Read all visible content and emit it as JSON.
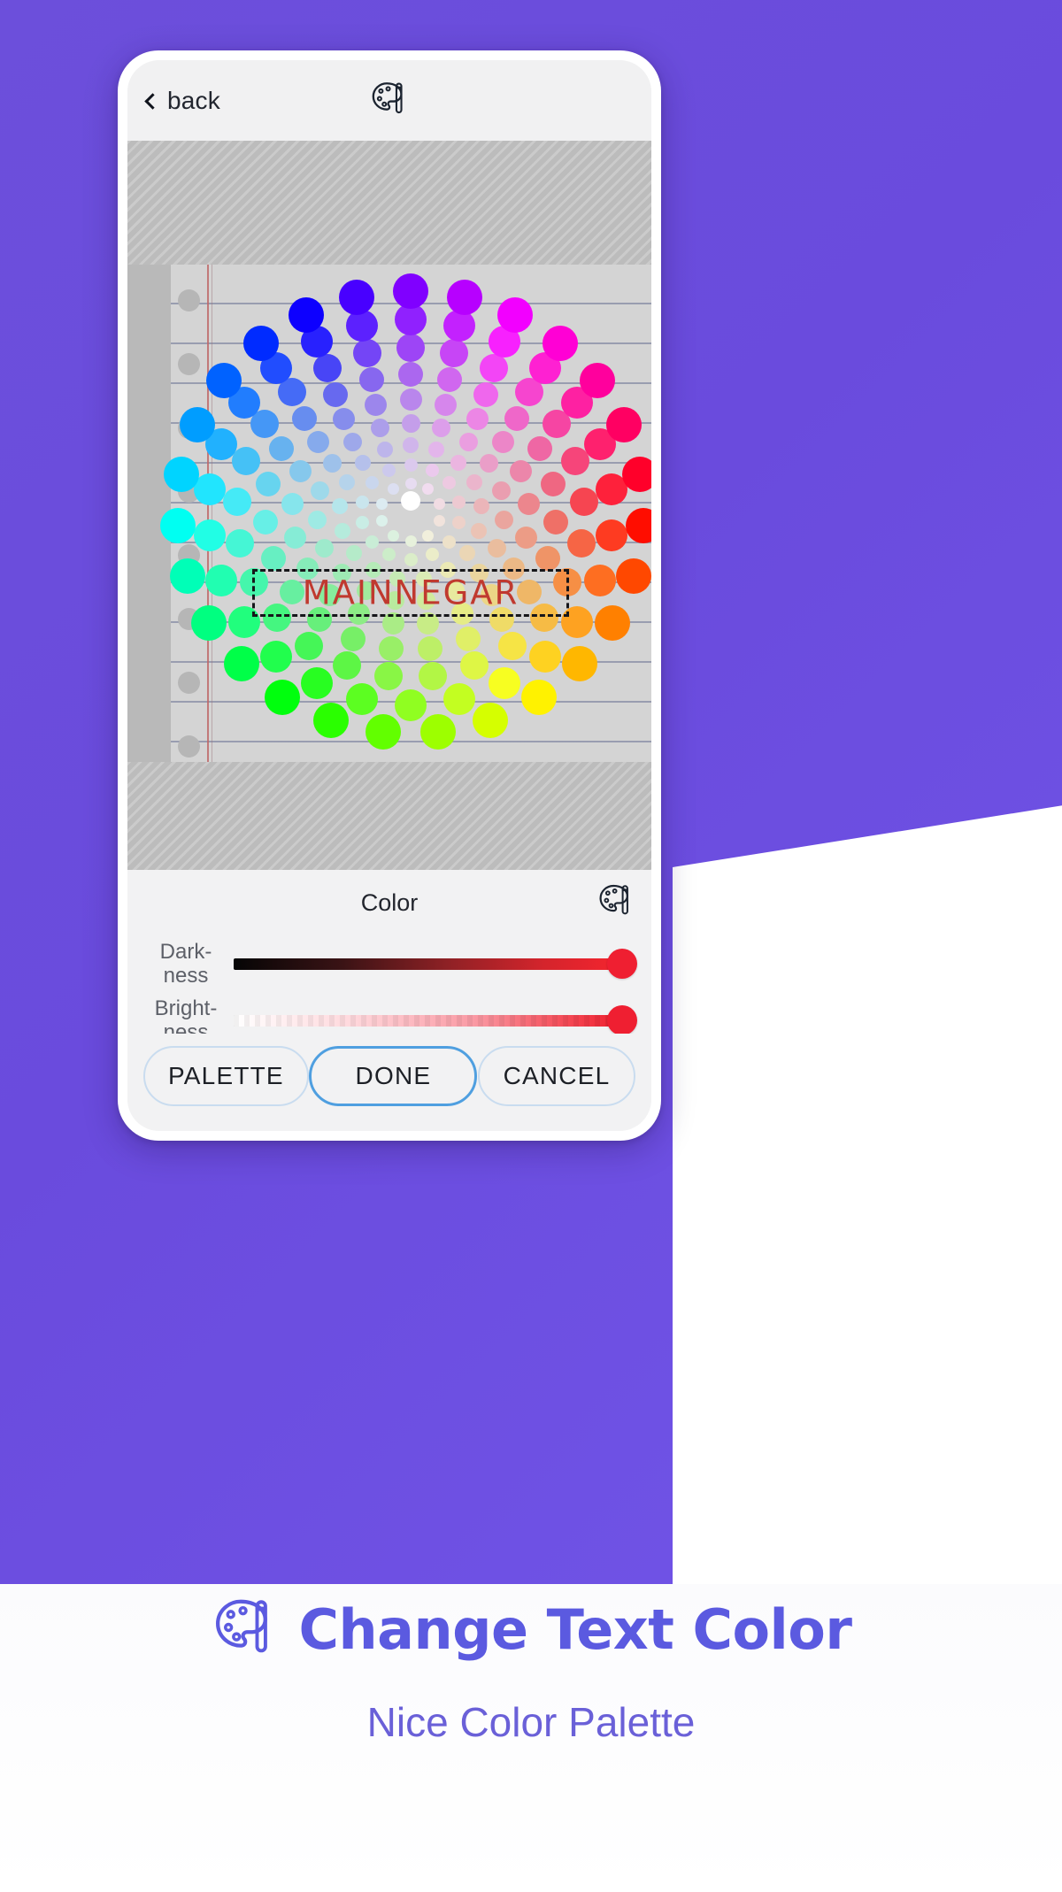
{
  "theme": {
    "brand_purple": "#6a4bdd",
    "caption_purple": "#5b5ae0",
    "subtitle_purple": "#6a60d8",
    "accent_blue": "#4f9fe0",
    "slider_thumb_red": "#ef1f31",
    "text_object_red": "#c0392f"
  },
  "phone": {
    "topbar": {
      "back_label": "back",
      "back_icon": "chevron-left-icon",
      "center_icon": "palette-brush-icon"
    },
    "canvas": {
      "text_object_value": "MAINNEGAR",
      "selection": "dashed-bounding-box"
    },
    "color_panel": {
      "title": "Color",
      "panel_icon": "palette-brush-icon",
      "sliders": [
        {
          "label_line1": "Dark-",
          "label_line2": "ness",
          "name": "darkness",
          "value_percent": 100,
          "gradient_from": "#050505",
          "gradient_to": "#f5252f"
        },
        {
          "label_line1": "Bright-",
          "label_line2": "ness",
          "name": "brightness",
          "value_percent": 100,
          "gradient_from": "#ffffff",
          "gradient_to": "#ef1d2c"
        }
      ]
    },
    "actions": {
      "palette_label": "PALETTE",
      "done_label": "DONE",
      "cancel_label": "CANCEL"
    }
  },
  "caption": {
    "icon": "palette-brush-icon",
    "title": "Change Text Color",
    "subtitle": "Nice Color Palette"
  }
}
